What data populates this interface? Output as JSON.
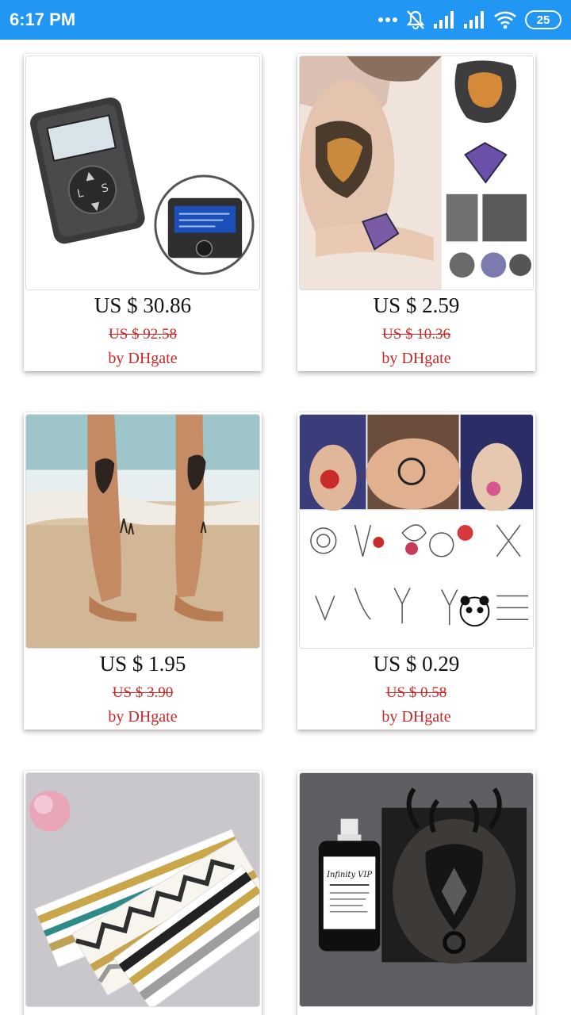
{
  "status_bar": {
    "time": "6:17 PM",
    "battery": "25",
    "icons": [
      "more-dots-icon",
      "mute-icon",
      "signal-icon",
      "signal-icon",
      "wifi-icon",
      "battery-icon"
    ]
  },
  "products": [
    {
      "price": "US $ 30.86",
      "original_price": "US $ 92.58",
      "seller": "by DHgate",
      "image": "tattoo-power-supply-image"
    },
    {
      "price": "US $ 2.59",
      "original_price": "US $ 10.36",
      "seller": "by DHgate",
      "image": "tiger-temporary-tattoo-image"
    },
    {
      "price": "US $ 1.95",
      "original_price": "US $ 3.90",
      "seller": "by DHgate",
      "image": "leg-tiger-tattoo-beach-image"
    },
    {
      "price": "US $ 0.29",
      "original_price": "US $ 0.58",
      "seller": "by DHgate",
      "image": "flower-panda-tattoo-sheet-image"
    },
    {
      "price": "",
      "original_price": "",
      "seller": "",
      "image": "metallic-flash-tattoo-sheets-image"
    },
    {
      "price": "",
      "original_price": "",
      "seller": "",
      "image": "tattoo-ink-bottle-deer-image"
    }
  ],
  "colors": {
    "status_bar": "#2196f3",
    "price_text": "#111111",
    "sale_red": "#c62828"
  }
}
